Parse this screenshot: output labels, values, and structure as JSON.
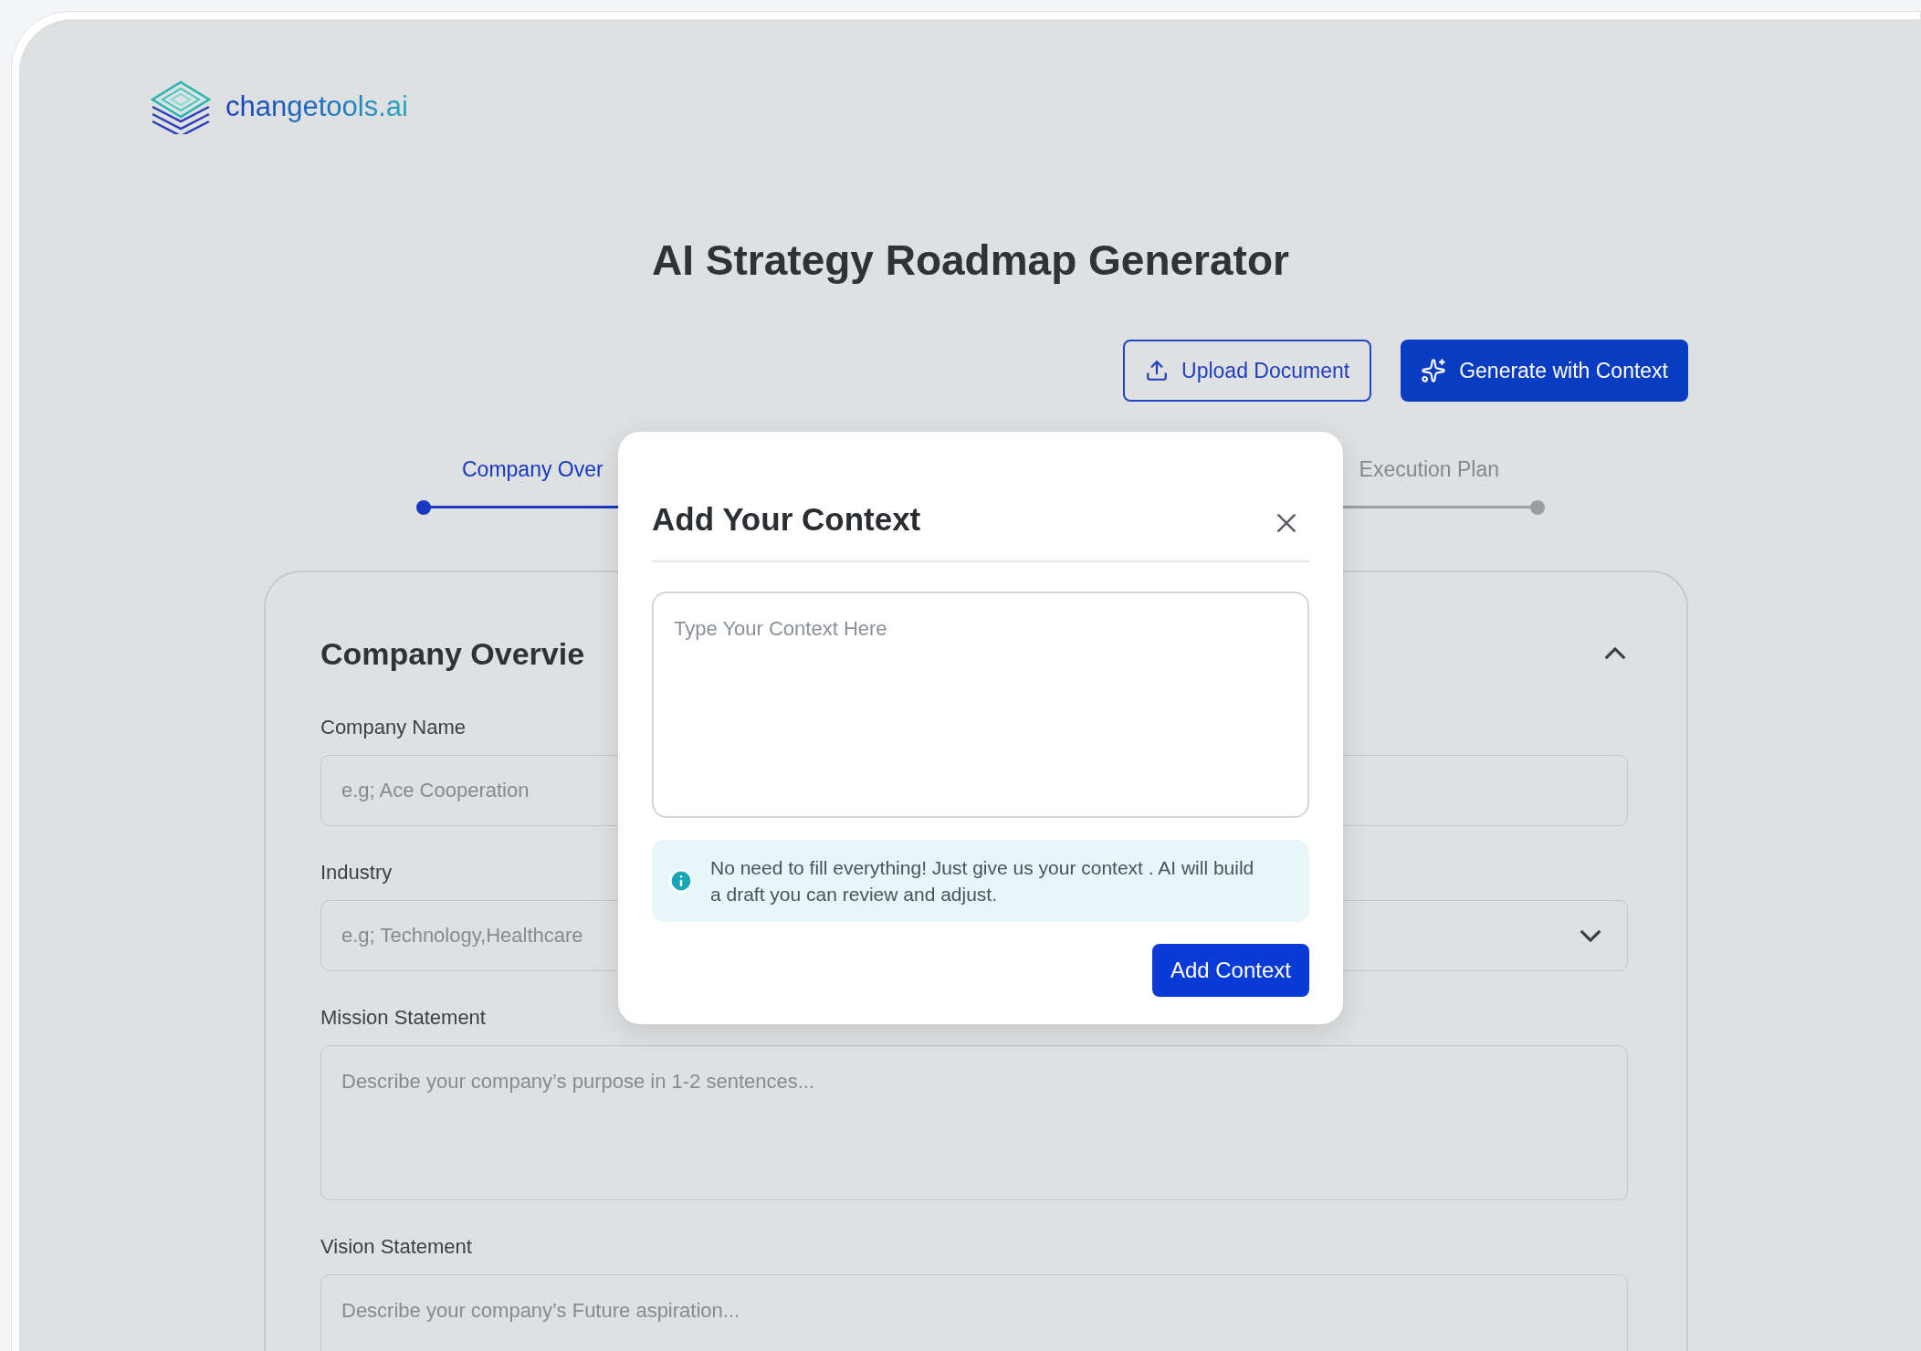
{
  "logo": {
    "text": "changetools.ai"
  },
  "title": "AI Strategy Roadmap Generator",
  "actions": [
    {
      "label": "Upload Document",
      "kind": "outline"
    },
    {
      "label": "Generate with Context",
      "kind": "primary"
    }
  ],
  "steps": [
    {
      "label": "Company Over",
      "selected": true
    },
    {
      "label": "Execution Plan",
      "selected": false
    }
  ],
  "section": {
    "title": "Company Overvie",
    "expanded": true
  },
  "fields": [
    {
      "label": "Company Name",
      "kind": "input",
      "placeholder": "e.g; Ace Cooperation"
    },
    {
      "label": "Industry",
      "kind": "select",
      "placeholder": "e.g; Technology,Healthcare"
    },
    {
      "label": "Mission Statement",
      "kind": "textarea",
      "placeholder": "Describe your company’s purpose in 1-2 sentences..."
    },
    {
      "label": "Vision Statement",
      "kind": "textarea",
      "placeholder": "Describe your company’s Future aspiration..."
    }
  ],
  "modal": {
    "title": "Add Your Context",
    "placeholder": "Type Your Context Here",
    "note": "No need to fill everything! Just give us your context . AI will build a draft you can review and adjust.",
    "button": "Add Context"
  }
}
